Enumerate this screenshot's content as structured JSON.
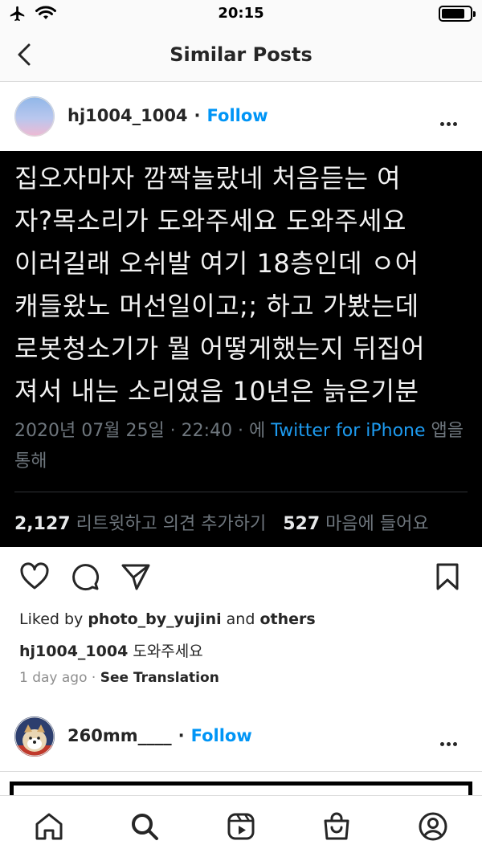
{
  "status_bar": {
    "time": "20:15"
  },
  "nav": {
    "title": "Similar Posts"
  },
  "post1": {
    "username": "hj1004_1004",
    "separator": "·",
    "follow_label": "Follow",
    "tweet_lines": [
      "집오자마자 깜짝놀랐네 처음듣는 여",
      "자?목소리가 도와주세요 도와주세요",
      "이러길래 오쉬발 여기 18층인데 ㅇ어",
      "캐들왔노 머선일이고;; 하고 가봤는데",
      "로봇청소기가 뭘 어떻게했는지 뒤집어",
      "져서 내는 소리였음 10년은 늙은기분"
    ],
    "tweet_meta_prefix": "2020년 07월 25일 · 22:40 · 에 ",
    "tweet_meta_source": "Twitter for iPhone",
    "tweet_meta_suffix": " 앱을",
    "tweet_meta_line2": "통해",
    "retweets_count": "2,127",
    "retweets_label": " 리트윗하고 의견 추가하기",
    "likes_count": "527",
    "likes_label": " 마음에 들어요",
    "liked_by_prefix": "Liked by ",
    "liked_by_user": "photo_by_yujini",
    "liked_by_and": " and ",
    "liked_by_others": "others",
    "caption_user": "hj1004_1004",
    "caption_text": " 도와주세요",
    "time_ago": "1 day ago",
    "time_sep": " · ",
    "see_translation": "See Translation"
  },
  "post2": {
    "username": "260mm____",
    "separator": "·",
    "follow_label": "Follow"
  },
  "icons": {
    "status_left": [
      "airplane-icon",
      "wifi-icon"
    ],
    "actions": [
      "heart-icon",
      "comment-icon",
      "share-icon",
      "bookmark-icon"
    ],
    "tabs": [
      "home-icon",
      "search-icon",
      "reels-icon",
      "shop-icon",
      "profile-icon"
    ]
  },
  "colors": {
    "accent_blue": "#0095f6",
    "twitter_blue": "#1d9bf0",
    "tweet_bg": "#000000"
  }
}
